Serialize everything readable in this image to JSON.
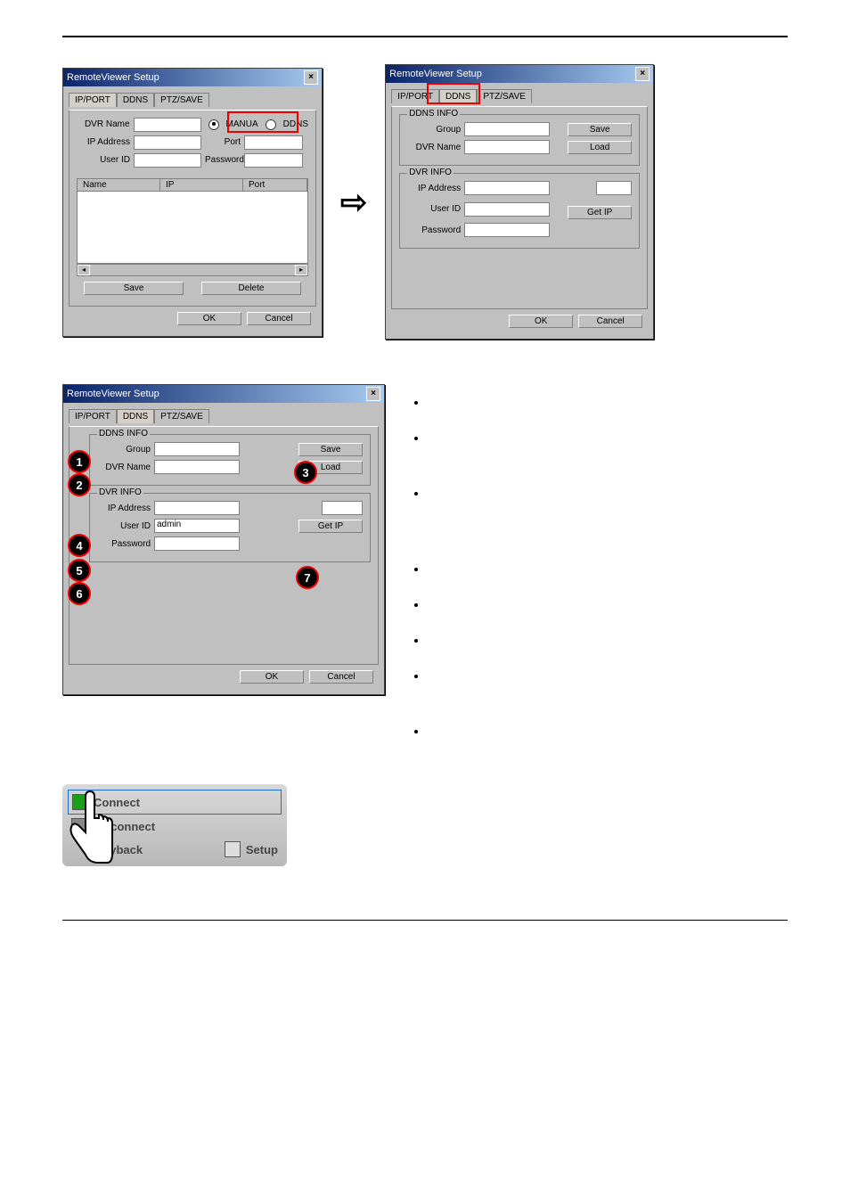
{
  "dialog1": {
    "title": "RemoteViewer Setup",
    "tabs": {
      "ipport": "IP/PORT",
      "ddns": "DDNS",
      "ptz": "PTZ/SAVE"
    },
    "labels": {
      "dvrname": "DVR Name",
      "ipaddress": "IP Address",
      "userid": "User ID",
      "port": "Port",
      "password": "Password"
    },
    "radios": {
      "manual": "MANUA",
      "ddns": "DDNS"
    },
    "list": {
      "col1": "Name",
      "col2": "IP",
      "col3": "Port"
    },
    "buttons": {
      "save": "Save",
      "delete": "Delete",
      "ok": "OK",
      "cancel": "Cancel"
    }
  },
  "dialog2": {
    "title": "RemoteViewer Setup",
    "tabs": {
      "ipport": "IP/PORT",
      "ddns": "DDNS",
      "ptz": "PTZ/SAVE"
    },
    "sections": {
      "ddnsinfo": "DDNS INFO",
      "dvrinfo": "DVR INFO"
    },
    "labels": {
      "group": "Group",
      "dvrname": "DVR Name",
      "ipaddress": "IP Address",
      "userid": "User ID",
      "password": "Password"
    },
    "buttons": {
      "save": "Save",
      "load": "Load",
      "getip": "Get IP",
      "ok": "OK",
      "cancel": "Cancel"
    }
  },
  "dialog3": {
    "title": "RemoteViewer Setup",
    "tabs": {
      "ipport": "IP/PORT",
      "ddns": "DDNS",
      "ptz": "PTZ/SAVE"
    },
    "sections": {
      "ddnsinfo": "DDNS INFO",
      "dvrinfo": "DVR INFO"
    },
    "labels": {
      "group": "Group",
      "dvrname": "DVR Name",
      "ipaddress": "IP Address",
      "userid": "User ID",
      "password": "Password"
    },
    "values": {
      "userid": "admin"
    },
    "buttons": {
      "save": "Save",
      "load": "Load",
      "getip": "Get IP",
      "ok": "OK",
      "cancel": "Cancel"
    }
  },
  "callouts": {
    "c1": "1",
    "c2": "2",
    "c3": "3",
    "c4": "4",
    "c5": "5",
    "c6": "6",
    "c7": "7"
  },
  "remote": {
    "connect": "Connect",
    "disconnect": "Disconnect",
    "playback": "ayback",
    "setup": "Setup"
  }
}
